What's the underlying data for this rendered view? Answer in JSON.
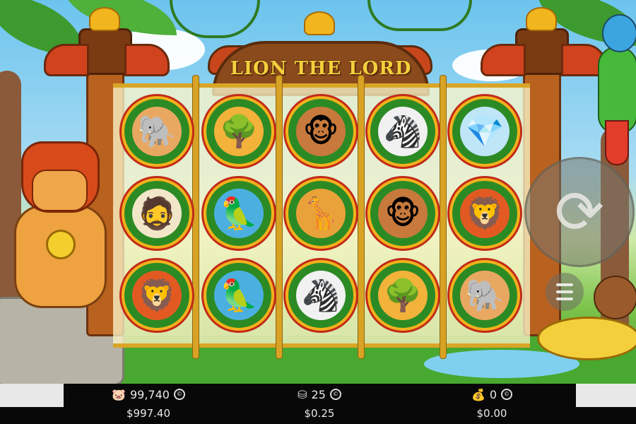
{
  "game": {
    "title": "LION THE LORD"
  },
  "reels": {
    "columns": [
      [
        "elephant",
        "tree",
        "monkey",
        "zebra",
        "diamond"
      ],
      [
        "explorer",
        "parrot",
        "giraffe",
        "monkey",
        "lion"
      ],
      [
        "lion",
        "parrot",
        "zebra",
        "tree",
        "elephant"
      ]
    ],
    "symbol_glyphs": {
      "elephant": "🐘",
      "tree": "🌳",
      "monkey": "🐵",
      "zebra": "🦓",
      "diamond": "💎",
      "explorer": "🧔",
      "parrot": "🦜",
      "giraffe": "🦒",
      "lion": "🦁"
    }
  },
  "controls": {
    "spin_icon": "refresh-icon",
    "spin_glyph": "⟳",
    "menu_icon": "hamburger-menu-icon"
  },
  "status_bar": {
    "balance": {
      "icon": "piggy-bank-icon",
      "glyph": "🐷",
      "coins": "99,740",
      "money": "$997.40"
    },
    "bet": {
      "icon": "stacked-coins-icon",
      "glyph": "⛁",
      "coins": "25",
      "money": "$0.25"
    },
    "win": {
      "icon": "coin-bag-icon",
      "glyph": "💰",
      "coins": "0",
      "money": "$0.00"
    },
    "coin_symbol": "©"
  },
  "colors": {
    "frame_gold": "#f2b21c",
    "symbol_ring_red": "#c22a18",
    "symbol_bg_green": "#2c8a24",
    "bar_bg": "#080808"
  }
}
